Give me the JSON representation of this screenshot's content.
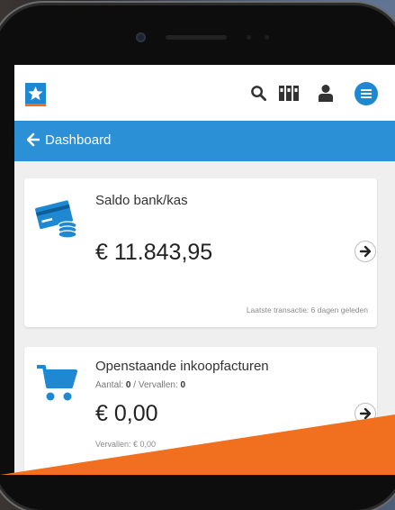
{
  "header": {
    "icons": [
      "star-logo",
      "search-icon",
      "binders-icon",
      "user-icon",
      "menu-icon"
    ]
  },
  "nav": {
    "back_label": "Dashboard"
  },
  "cards": [
    {
      "title": "Saldo bank/kas",
      "amount": "€ 11.843,95",
      "footer": "Laatste transactie: 6 dagen geleden",
      "icon": "bank-card-coins-icon"
    },
    {
      "title": "Openstaande inkoopfacturen",
      "count_label": "Aantal:",
      "count_value": "0",
      "separator": " / ",
      "overdue_label": "Vervallen:",
      "overdue_value": "0",
      "amount": "€ 0,00",
      "overdue_amount": "Vervallen: € 0,00",
      "icon": "shopping-cart-icon"
    }
  ],
  "colors": {
    "brand": "#2b90d6",
    "accent": "#f07020"
  }
}
